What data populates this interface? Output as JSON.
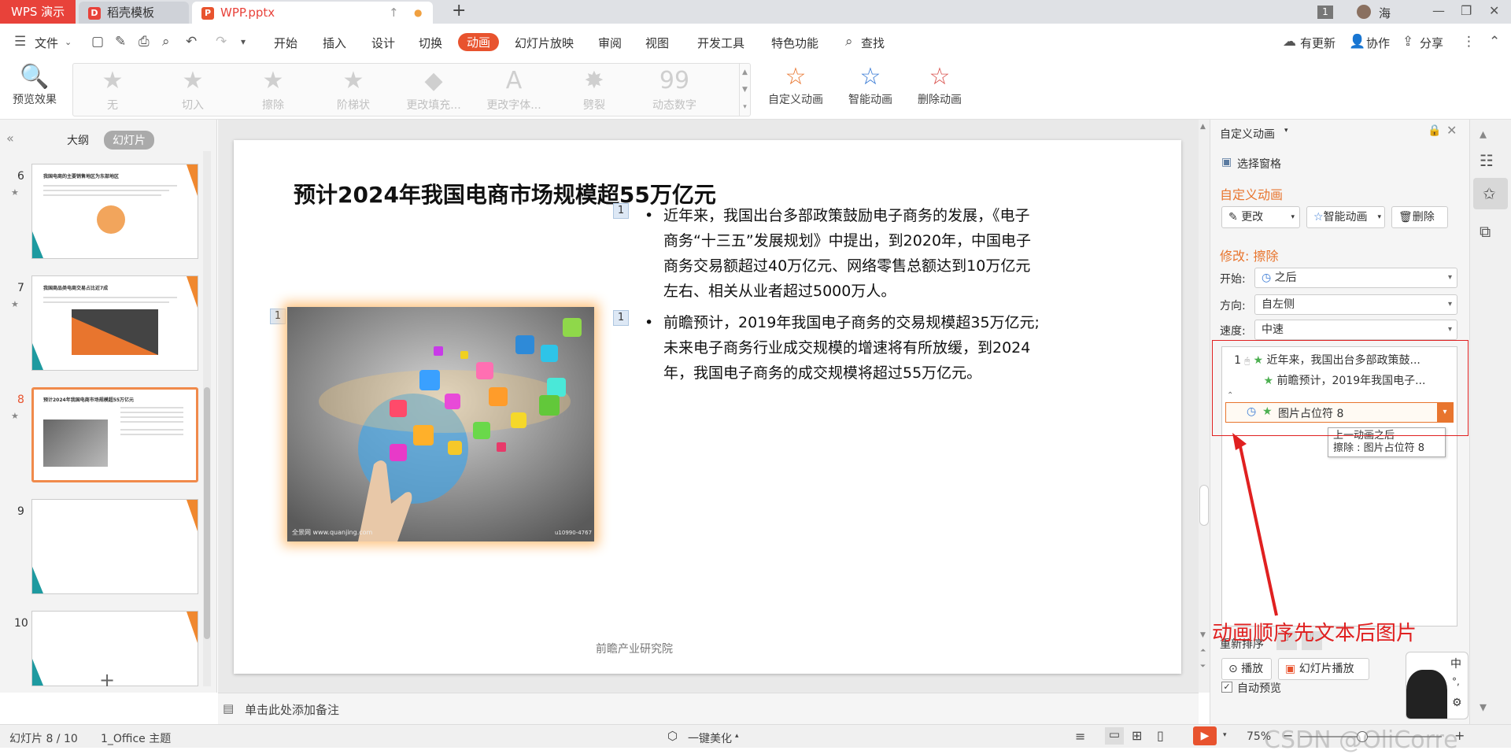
{
  "titlebar": {
    "app_label": "WPS 演示",
    "tabs": [
      {
        "label": "稻壳模板"
      },
      {
        "label": "WPP.pptx"
      }
    ],
    "page_badge": "1",
    "user": "海"
  },
  "menubar": {
    "file": "文件",
    "items": [
      "开始",
      "插入",
      "设计",
      "切换",
      "动画",
      "幻灯片放映",
      "审阅",
      "视图",
      "开发工具",
      "特色功能"
    ],
    "active": "动画",
    "search": "查找",
    "right": [
      "有更新",
      "协作",
      "分享"
    ]
  },
  "ribbon": {
    "preview": "预览效果",
    "gallery": [
      "无",
      "切入",
      "擦除",
      "阶梯状",
      "更改填充...",
      "更改字体...",
      "劈裂",
      "动态数字"
    ],
    "custom": "自定义动画",
    "smart": "智能动画",
    "delete": "删除动画"
  },
  "leftpanel": {
    "tab_outline": "大纲",
    "tab_slides": "幻灯片",
    "thumbnails": [
      {
        "num": "6",
        "title": "我国电商的主要销售地区为东部地区"
      },
      {
        "num": "7",
        "title": "我国商品类电商交易占比近7成"
      },
      {
        "num": "8",
        "title": "预计2024年我国电商市场规模超55万亿元"
      },
      {
        "num": "9",
        "title": ""
      },
      {
        "num": "10",
        "title": ""
      }
    ]
  },
  "slide": {
    "title": "预计2024年我国电商市场规模超55万亿元",
    "image_badge": "1",
    "paragraphs": [
      {
        "badge": "1",
        "text": "近年来，我国出台多部政策鼓励电子商务的发展，《电子商务“十三五”发展规划》中提出，到2020年，中国电子商务交易额超过40万亿元、网络零售总额达到10万亿元左右、相关从业者超过5000万人。"
      },
      {
        "badge": "1",
        "text": "前瞻预计，2019年我国电子商务的交易规模超35万亿元;未来电子商务行业成交规模的增速将有所放缓，到2024年，我国电子商务的成交规模将超过55万亿元。"
      }
    ],
    "image_caption_left": "全景网 www.quanjing.com",
    "image_caption_right": "u10990-4767",
    "footer": "前瞻产业研究院"
  },
  "notes": {
    "placeholder": "单击此处添加备注"
  },
  "status": {
    "slide_info": "幻灯片 8 / 10",
    "theme": "1_Office 主题",
    "beautify": "一键美化",
    "zoom": "75%"
  },
  "rightpanel": {
    "header": "自定义动画",
    "select_pane": "选择窗格",
    "section": "自定义动画",
    "btn_change": "更改",
    "btn_smart": "智能动画",
    "btn_delete": "删除",
    "modify": "修改: 擦除",
    "start_label": "开始:",
    "start_value": "之后",
    "direction_label": "方向:",
    "direction_value": "自左侧",
    "speed_label": "速度:",
    "speed_value": "中速",
    "anim_items": [
      {
        "num": "1",
        "text": "近年来，我国出台多部政策鼓..."
      },
      {
        "num": "",
        "text": "前瞻预计，2019年我国电子..."
      },
      {
        "num": "",
        "text": "图片占位符 8"
      }
    ],
    "tooltip_line1": "上一动画之后",
    "tooltip_line2": "擦除 : 图片占位符 8",
    "annotation": "动画顺序先文本后图片",
    "reorder": "重新排序",
    "play": "播放",
    "slideshow": "幻灯片播放",
    "autopreview": "自动预览"
  },
  "watermark": "CSDN @OliCorre",
  "colors": {
    "accent": "#e8532e",
    "annotation": "#e02020",
    "wps_red": "#e8423a"
  }
}
